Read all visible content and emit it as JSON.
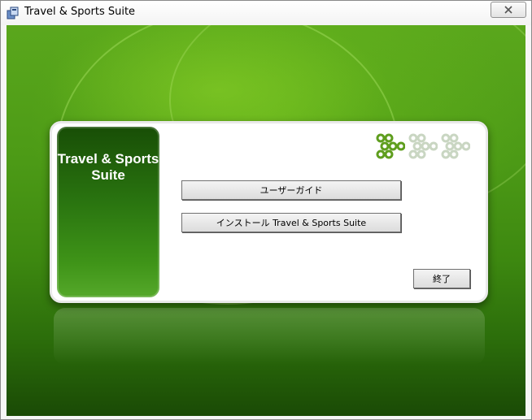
{
  "window": {
    "title": "Travel & Sports Suite",
    "close_label": "X"
  },
  "sidebar": {
    "title": "Travel & Sports\nSuite"
  },
  "steps": {
    "active_index": 0,
    "count": 3
  },
  "buttons": {
    "user_guide": "ユーザーガイド",
    "install": "インストール Travel & Sports Suite",
    "exit": "終了"
  },
  "colors": {
    "accent_green": "#5aa71c",
    "step_active": "#5f9e1e",
    "step_inactive": "#c9d6c2"
  }
}
